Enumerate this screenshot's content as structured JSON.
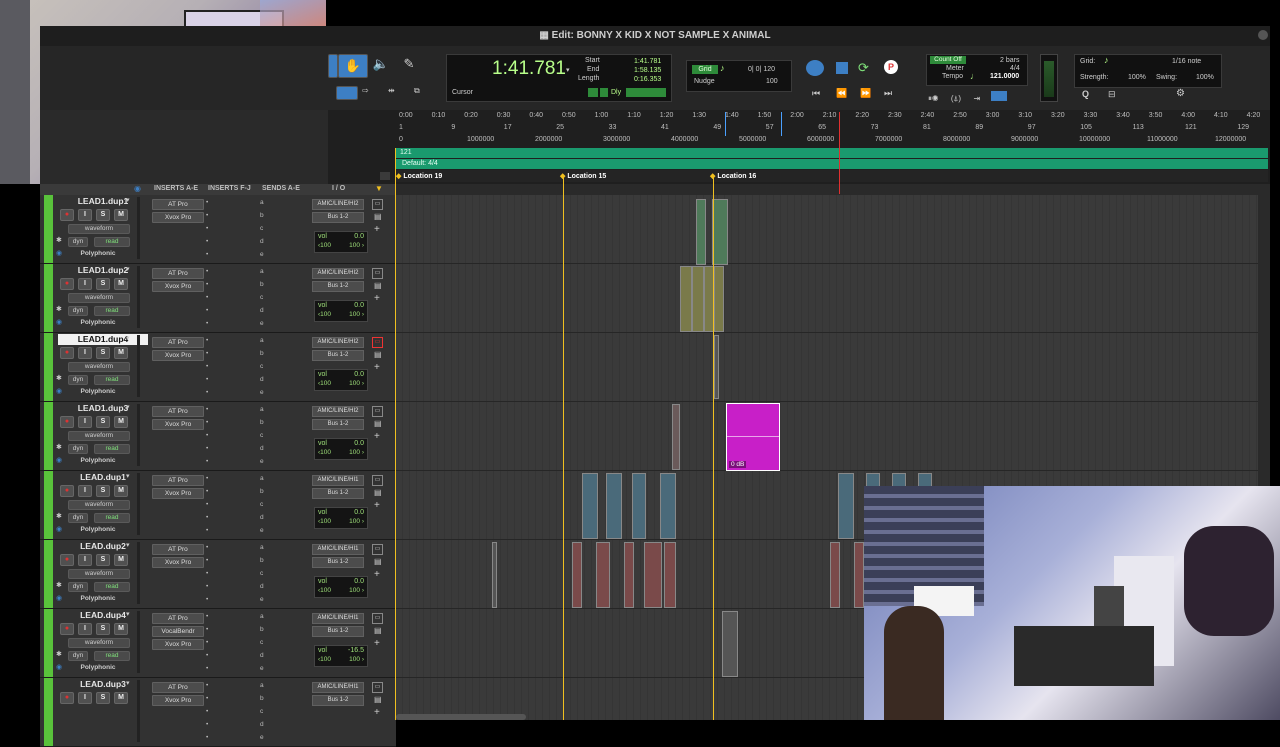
{
  "window": {
    "title": "Edit: BONNY X KID X NOT SAMPLE X ANIMAL"
  },
  "counter": {
    "main": "1:41.781",
    "start_label": "Start",
    "end_label": "End",
    "length_label": "Length",
    "start": "1:41.781",
    "end": "1:58.135",
    "length": "0:16.353",
    "cursor_label": "Cursor"
  },
  "grid_nudge": {
    "grid_label": "Grid",
    "grid_value": "0| 0| 120",
    "nudge_label": "Nudge",
    "nudge_value": "100",
    "dly_label": "Dly"
  },
  "meter": {
    "count_off": "Count Off",
    "bars": "2 bars",
    "meter_label": "Meter",
    "meter_value": "4/4",
    "tempo_label": "Tempo",
    "tempo_value": "121.0000"
  },
  "right_panel": {
    "grid_label": "Grid:",
    "grid_value": "1/16 note",
    "strength_label": "Strength:",
    "strength_value": "100%",
    "swing_label": "Swing:",
    "swing_value": "100%"
  },
  "ruler": {
    "minsecs": [
      "0:00",
      "0:10",
      "0:20",
      "0:30",
      "0:40",
      "0:50",
      "1:00",
      "1:10",
      "1:20",
      "1:30",
      "1:40",
      "1:50",
      "2:00",
      "2:10",
      "2:20",
      "2:30",
      "2:40",
      "2:50",
      "3:00",
      "3:10",
      "3:20",
      "3:30",
      "3:40",
      "3:50",
      "4:00",
      "4:10",
      "4:20"
    ],
    "bars": [
      "1",
      "9",
      "17",
      "25",
      "33",
      "41",
      "49",
      "57",
      "65",
      "73",
      "81",
      "89",
      "97",
      "105",
      "113",
      "121",
      "129"
    ],
    "samples": [
      "0",
      "1000000",
      "2000000",
      "3000000",
      "4000000",
      "5000000",
      "6000000",
      "7000000",
      "8000000",
      "9000000",
      "10000000",
      "11000000",
      "12000000"
    ],
    "tempo_marker": "121",
    "meter_marker": "Default: 4/4",
    "markers": [
      "Location 19",
      "Location 15",
      "Location 16"
    ]
  },
  "columns": {
    "inserts_ae": "INSERTS A-E",
    "inserts_fj": "INSERTS F-J",
    "sends_ae": "SENDS A-E",
    "io": "I / O"
  },
  "send_letters": [
    "a",
    "b",
    "c",
    "d",
    "e"
  ],
  "tracks": [
    {
      "name": "LEAD1.dup1",
      "inserts": [
        "AT Pro",
        "Xvox Pro"
      ],
      "input": "AMIC/LINE/HI2",
      "output": "Bus 1-2",
      "vol": "0.0",
      "pan_l": "‹100",
      "pan_r": "100 ›",
      "view": "waveform",
      "dyn": "dyn",
      "auto": "read",
      "mode": "Polyphonic"
    },
    {
      "name": "LEAD1.dup2",
      "inserts": [
        "AT Pro",
        "Xvox Pro"
      ],
      "input": "AMIC/LINE/HI2",
      "output": "Bus 1-2",
      "vol": "0.0",
      "pan_l": "‹100",
      "pan_r": "100 ›",
      "view": "waveform",
      "dyn": "dyn",
      "auto": "read",
      "mode": "Polyphonic"
    },
    {
      "name": "LEAD1.dup4",
      "inserts": [
        "AT Pro",
        "Xvox Pro"
      ],
      "input": "AMIC/LINE/HI2",
      "output": "Bus 1-2",
      "vol": "0.0",
      "pan_l": "‹100",
      "pan_r": "100 ›",
      "view": "waveform",
      "dyn": "dyn",
      "auto": "read",
      "mode": "Polyphonic"
    },
    {
      "name": "LEAD1.dup3",
      "inserts": [
        "AT Pro",
        "Xvox Pro"
      ],
      "input": "AMIC/LINE/HI2",
      "output": "Bus 1-2",
      "vol": "0.0",
      "pan_l": "‹100",
      "pan_r": "100 ›",
      "view": "waveform",
      "dyn": "dyn",
      "auto": "read",
      "mode": "Polyphonic"
    },
    {
      "name": "LEAD.dup1",
      "inserts": [
        "AT Pro",
        "Xvox Pro"
      ],
      "input": "AMIC/LINE/HI1",
      "output": "Bus 1-2",
      "vol": "0.0",
      "pan_l": "‹100",
      "pan_r": "100 ›",
      "view": "waveform",
      "dyn": "dyn",
      "auto": "read",
      "mode": "Polyphonic"
    },
    {
      "name": "LEAD.dup2",
      "inserts": [
        "AT Pro",
        "Xvox Pro"
      ],
      "input": "AMIC/LINE/HI1",
      "output": "Bus 1-2",
      "vol": "0.0",
      "pan_l": "‹100",
      "pan_r": "100 ›",
      "view": "waveform",
      "dyn": "dyn",
      "auto": "read",
      "mode": "Polyphonic"
    },
    {
      "name": "LEAD.dup4",
      "inserts": [
        "AT Pro",
        "VocalBendr",
        "Xvox Pro"
      ],
      "input": "AMIC/LINE/HI1",
      "output": "Bus 1-2",
      "vol": "-16.5",
      "pan_l": "‹100",
      "pan_r": "100 ›",
      "view": "waveform",
      "dyn": "dyn",
      "auto": "read",
      "mode": "Polyphonic"
    },
    {
      "name": "LEAD.dup3",
      "inserts": [
        "AT Pro",
        "Xvox Pro"
      ],
      "input": "AMIC/LINE/HI1",
      "output": "Bus 1-2",
      "vol": "",
      "pan_l": "",
      "pan_r": "",
      "view": "",
      "dyn": "",
      "auto": "",
      "mode": ""
    }
  ],
  "clip_gain_label": "0 dB",
  "colors": {
    "track_green": "#59c23b",
    "ruler_teal": "#1a9a6e",
    "marker_yellow": "#f0c020",
    "selected_clip": "#c81fc8",
    "cursor_blue": "#4aa0ff",
    "playhead_red": "#e03030"
  }
}
